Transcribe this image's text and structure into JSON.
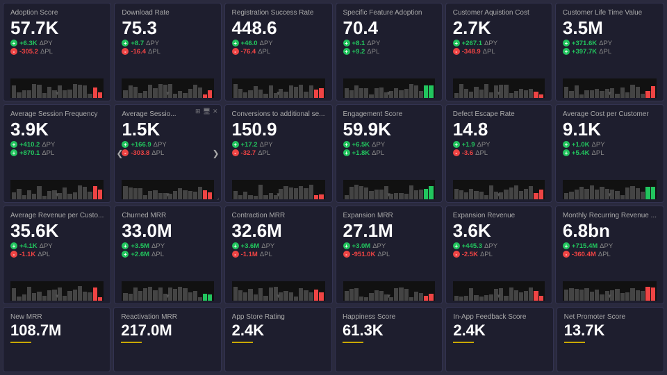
{
  "cards": [
    {
      "id": "adoption-score",
      "title": "Adoption Score",
      "value": "57.7K",
      "deltas": [
        {
          "sign": "+",
          "color": "green",
          "value": "+6.3K",
          "label": "ΔPY"
        },
        {
          "sign": "-",
          "color": "red",
          "value": "-305.2",
          "label": "ΔPL"
        }
      ],
      "indicator": "red"
    },
    {
      "id": "download-rate",
      "title": "Download Rate",
      "value": "75.3",
      "deltas": [
        {
          "sign": "+",
          "color": "green",
          "value": "+8.7",
          "label": "ΔPY"
        },
        {
          "sign": "-",
          "color": "red",
          "value": "-16.4",
          "label": "ΔPL"
        }
      ],
      "indicator": "red"
    },
    {
      "id": "registration-success-rate",
      "title": "Registration Success Rate",
      "value": "448.6",
      "deltas": [
        {
          "sign": "+",
          "color": "green",
          "value": "+46.0",
          "label": "ΔPY"
        },
        {
          "sign": "-",
          "color": "red",
          "value": "-76.4",
          "label": "ΔPL"
        }
      ],
      "indicator": "red"
    },
    {
      "id": "specific-feature-adoption",
      "title": "Specific Feature Adoption",
      "value": "70.4",
      "deltas": [
        {
          "sign": "+",
          "color": "green",
          "value": "+8.1",
          "label": "ΔPY"
        },
        {
          "sign": "+",
          "color": "green",
          "value": "+9.2",
          "label": "ΔPL"
        }
      ],
      "indicator": "green"
    },
    {
      "id": "customer-acquisition-cost",
      "title": "Customer Aquistion Cost",
      "value": "2.7K",
      "deltas": [
        {
          "sign": "+",
          "color": "green",
          "value": "+267.1",
          "label": "ΔPY"
        },
        {
          "sign": "-",
          "color": "red",
          "value": "-348.9",
          "label": "ΔPL"
        }
      ],
      "indicator": "red"
    },
    {
      "id": "customer-lifetime-value",
      "title": "Customer Life Time Value",
      "value": "3.5M",
      "deltas": [
        {
          "sign": "+",
          "color": "green",
          "value": "+371.6K",
          "label": "ΔPY"
        },
        {
          "sign": "+",
          "color": "green",
          "value": "+397.7K",
          "label": "ΔPL"
        }
      ],
      "indicator": "red"
    },
    {
      "id": "avg-session-frequency",
      "title": "Average Session Frequency",
      "value": "3.9K",
      "deltas": [
        {
          "sign": "+",
          "color": "green",
          "value": "+410.2",
          "label": "ΔPY"
        },
        {
          "sign": "+",
          "color": "green",
          "value": "+870.1",
          "label": "ΔPL"
        }
      ],
      "indicator": "red"
    },
    {
      "id": "avg-session",
      "title": "Average Sessio...",
      "value": "1.5K",
      "deltas": [
        {
          "sign": "+",
          "color": "green",
          "value": "+166.9",
          "label": "ΔPY"
        },
        {
          "sign": "-",
          "color": "red",
          "value": "-303.8",
          "label": "ΔPL"
        }
      ],
      "indicator": "right-arrow",
      "hasTools": true
    },
    {
      "id": "conversions-additional",
      "title": "Conversions to additional se...",
      "value": "150.9",
      "deltas": [
        {
          "sign": "+",
          "color": "green",
          "value": "+17.2",
          "label": "ΔPY"
        },
        {
          "sign": "-",
          "color": "red",
          "value": "-32.7",
          "label": "ΔPL"
        }
      ],
      "indicator": "red"
    },
    {
      "id": "engagement-score",
      "title": "Engagement Score",
      "value": "59.9K",
      "deltas": [
        {
          "sign": "+",
          "color": "green",
          "value": "+6.5K",
          "label": "ΔPY"
        },
        {
          "sign": "+",
          "color": "green",
          "value": "+1.8K",
          "label": "ΔPL"
        }
      ],
      "indicator": "green"
    },
    {
      "id": "defect-escape-rate",
      "title": "Defect Escape Rate",
      "value": "14.8",
      "deltas": [
        {
          "sign": "+",
          "color": "green",
          "value": "+1.9",
          "label": "ΔPY"
        },
        {
          "sign": "-",
          "color": "red",
          "value": "-3.6",
          "label": "ΔPL"
        }
      ],
      "indicator": "red"
    },
    {
      "id": "avg-cost-per-customer",
      "title": "Average Cost per Customer",
      "value": "9.1K",
      "deltas": [
        {
          "sign": "+",
          "color": "green",
          "value": "+1.0K",
          "label": "ΔPY"
        },
        {
          "sign": "+",
          "color": "green",
          "value": "+5.4K",
          "label": "ΔPL"
        }
      ],
      "indicator": "green"
    },
    {
      "id": "avg-revenue-per-customer",
      "title": "Average Revenue per Custo...",
      "value": "35.6K",
      "deltas": [
        {
          "sign": "+",
          "color": "green",
          "value": "+4.1K",
          "label": "ΔPY"
        },
        {
          "sign": "-",
          "color": "red",
          "value": "-1.1K",
          "label": "ΔPL"
        }
      ],
      "indicator": "red"
    },
    {
      "id": "churned-mrr",
      "title": "Churned MRR",
      "value": "33.0M",
      "deltas": [
        {
          "sign": "+",
          "color": "green",
          "value": "+3.5M",
          "label": "ΔPY"
        },
        {
          "sign": "+",
          "color": "green",
          "value": "+2.6M",
          "label": "ΔPL"
        }
      ],
      "indicator": "green"
    },
    {
      "id": "contraction-mrr",
      "title": "Contraction MRR",
      "value": "32.6M",
      "deltas": [
        {
          "sign": "+",
          "color": "green",
          "value": "+3.6M",
          "label": "ΔPY"
        },
        {
          "sign": "-",
          "color": "red",
          "value": "-1.1M",
          "label": "ΔPL"
        }
      ],
      "indicator": "red"
    },
    {
      "id": "expansion-mrr",
      "title": "Expansion MRR",
      "value": "27.1M",
      "deltas": [
        {
          "sign": "+",
          "color": "green",
          "value": "+3.0M",
          "label": "ΔPY"
        },
        {
          "sign": "-",
          "color": "red",
          "value": "-951.0K",
          "label": "ΔPL"
        }
      ],
      "indicator": "red"
    },
    {
      "id": "expansion-revenue",
      "title": "Expansion Revenue",
      "value": "3.6K",
      "deltas": [
        {
          "sign": "+",
          "color": "green",
          "value": "+445.3",
          "label": "ΔPY"
        },
        {
          "sign": "-",
          "color": "red",
          "value": "-2.5K",
          "label": "ΔPL"
        }
      ],
      "indicator": "red"
    },
    {
      "id": "monthly-recurring-revenue",
      "title": "Monthly Recurring Revenue ...",
      "value": "6.8bn",
      "deltas": [
        {
          "sign": "+",
          "color": "green",
          "value": "+715.4M",
          "label": "ΔPY"
        },
        {
          "sign": "-",
          "color": "red",
          "value": "-360.4M",
          "label": "ΔPL"
        }
      ],
      "indicator": "red"
    }
  ],
  "bottom_cards": [
    {
      "id": "new-mrr",
      "title": "New MRR",
      "value": "108.7M"
    },
    {
      "id": "reactivation-mrr",
      "title": "Reactivation MRR",
      "value": "217.0M"
    },
    {
      "id": "app-store-rating",
      "title": "App Store Rating",
      "value": "2.4K"
    },
    {
      "id": "happiness-score",
      "title": "Happiness Score",
      "value": "61.3K"
    },
    {
      "id": "in-app-feedback-score",
      "title": "In-App Feedback Score",
      "value": "2.4K"
    },
    {
      "id": "net-promoter-score",
      "title": "Net Promoter Score",
      "value": "13.7K"
    }
  ],
  "colors": {
    "green": "#22c55e",
    "red": "#ef4444",
    "bg": "#1e1e2e",
    "border": "#333350",
    "text_primary": "#ffffff",
    "text_secondary": "#aaaaaa"
  }
}
